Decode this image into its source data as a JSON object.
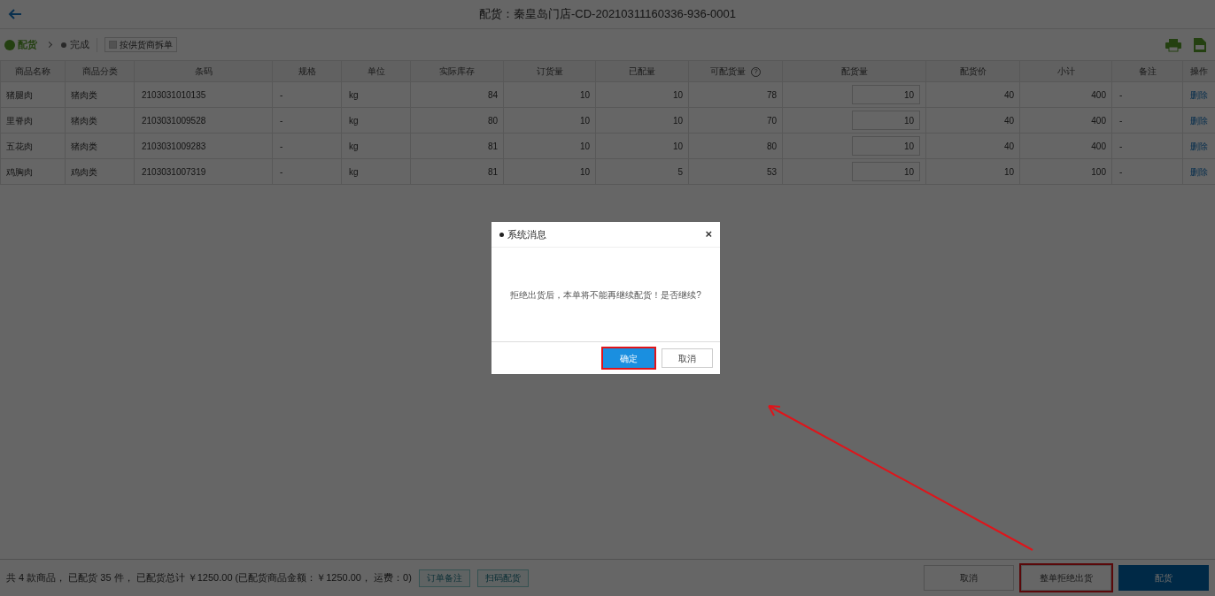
{
  "header": {
    "title": "配货：秦皇岛门店-CD-20210311160336-936-0001"
  },
  "steps": [
    {
      "label": "配货",
      "selected": true
    },
    {
      "label": "完成",
      "selected": false
    }
  ],
  "split_option": {
    "label": "按供货商拆单",
    "checked": false
  },
  "table": {
    "columns": [
      {
        "label": "商品名称"
      },
      {
        "label": "商品分类"
      },
      {
        "label": "条码"
      },
      {
        "label": "规格"
      },
      {
        "label": "单位"
      },
      {
        "label": "实际库存"
      },
      {
        "label": "订货量"
      },
      {
        "label": "已配量"
      },
      {
        "label": "可配货量",
        "help": "?"
      },
      {
        "label": "配货量"
      },
      {
        "label": "配货价"
      },
      {
        "label": "小计"
      },
      {
        "label": "备注"
      },
      {
        "label": "操作"
      }
    ],
    "rows": [
      {
        "cells": [
          "猪腿肉",
          "猪肉类",
          "2103031010135",
          "-",
          "kg",
          "84",
          "10",
          "10",
          "78",
          "10",
          "40",
          "400",
          "-",
          "删除"
        ]
      },
      {
        "cells": [
          "里脊肉",
          "猪肉类",
          "2103031009528",
          "-",
          "kg",
          "80",
          "10",
          "10",
          "70",
          "10",
          "40",
          "400",
          "-",
          "删除"
        ]
      },
      {
        "cells": [
          "五花肉",
          "猪肉类",
          "2103031009283",
          "-",
          "kg",
          "81",
          "10",
          "10",
          "80",
          "10",
          "40",
          "400",
          "-",
          "删除"
        ]
      },
      {
        "cells": [
          "鸡胸肉",
          "鸡肉类",
          "2103031007319",
          "-",
          "kg",
          "81",
          "10",
          "5",
          "53",
          "10",
          "10",
          "100",
          "-",
          "删除"
        ]
      }
    ]
  },
  "footer": {
    "summary": "共 4 款商品， 已配货 35 件， 已配货总计 ￥1250.00 (已配货商品金额：￥1250.00， 运费：0)",
    "tool_buttons": [
      "订单备注",
      "扫码配货"
    ],
    "actions": [
      {
        "label": "取消",
        "kind": "plain",
        "highlighted": false
      },
      {
        "label": "整单拒绝出货",
        "kind": "plain",
        "highlighted": true
      },
      {
        "label": "配货",
        "kind": "primary",
        "highlighted": false
      }
    ]
  },
  "dialog": {
    "title": "系统消息",
    "close": "×",
    "message": "拒绝出货后，本单将不能再继续配货！是否继续?",
    "buttons": [
      {
        "label": "确定",
        "kind": "primary",
        "highlighted": true
      },
      {
        "label": "取消",
        "kind": "plain",
        "highlighted": false
      }
    ]
  }
}
